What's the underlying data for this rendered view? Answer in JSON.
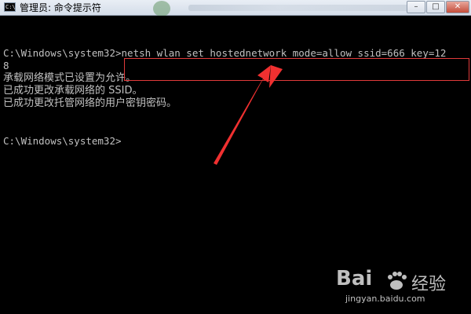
{
  "window": {
    "title": "管理员: 命令提示符",
    "icon_text": "C:\\",
    "buttons": {
      "minimize": "–",
      "maximize": "□",
      "close": "✕"
    }
  },
  "console": {
    "lines": [
      "C:\\Windows\\system32>netsh wlan set hostednetwork mode=allow ssid=666 key=12",
      "8",
      "承载网络模式已设置为允许。",
      "已成功更改承载网络的 SSID。",
      "已成功更改托管网络的用户密钥密码。",
      "C:\\Windows\\system32>"
    ]
  },
  "annotation": {
    "highlight_color": "#e03a3a",
    "arrow_color": "#f03030"
  },
  "watermark": {
    "logo": "Bai",
    "logo_tail": "经验",
    "url": "jingyan.baidu.com"
  }
}
